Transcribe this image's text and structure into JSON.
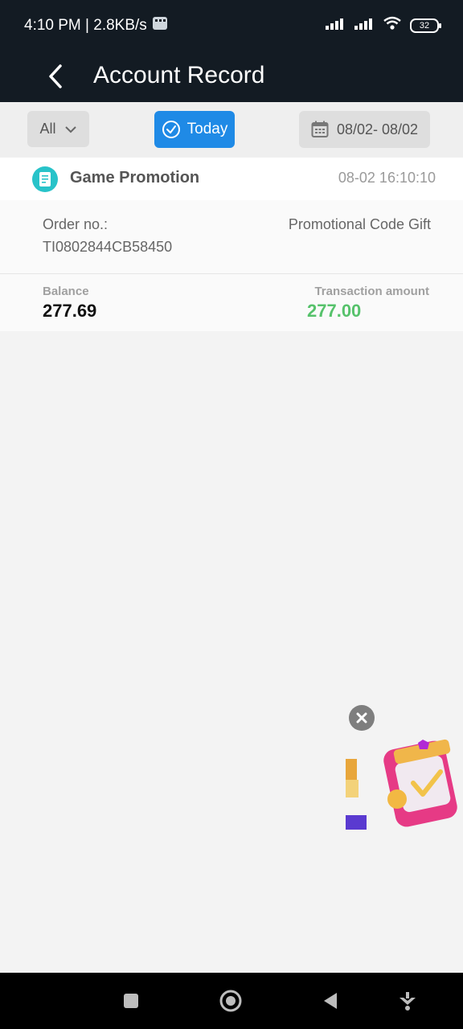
{
  "status": {
    "time_speed": "4:10 PM | 2.8KB/s",
    "battery": "32"
  },
  "header": {
    "title": "Account Record",
    "back_icon": "chevron-left-icon"
  },
  "filters": {
    "all_label": "All",
    "today_label": "Today",
    "date_range": "08/02- 08/02"
  },
  "record": {
    "title": "Game Promotion",
    "time": "08-02 16:10:10",
    "order_label": "Order no.:",
    "order_no": "TI0802844CB58450",
    "description": "Promotional Code Gift",
    "balance_label": "Balance",
    "balance": "277.69",
    "transaction_label": "Transaction amount",
    "transaction_amount": "277.00"
  },
  "colors": {
    "header_bg": "#131b23",
    "accent": "#1f8ae6",
    "positive": "#56c26b"
  }
}
